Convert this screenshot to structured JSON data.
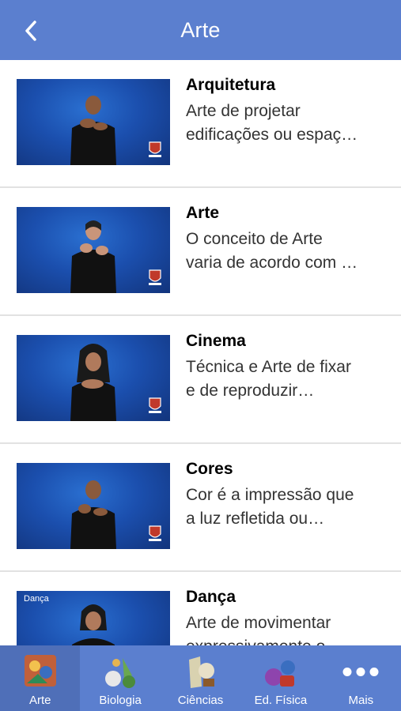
{
  "header": {
    "title": "Arte"
  },
  "items": [
    {
      "name": "Arquitetura",
      "desc1": "Arte de projetar",
      "desc2": "edificações ou espaç…",
      "caption": ""
    },
    {
      "name": "Arte",
      "desc1": "O conceito de Arte",
      "desc2": "varia de acordo com …",
      "caption": ""
    },
    {
      "name": "Cinema",
      "desc1": "Técnica e Arte de fixar",
      "desc2": "e de reproduzir…",
      "caption": ""
    },
    {
      "name": "Cores",
      "desc1": "Cor é a impressão que",
      "desc2": "a luz refletida ou…",
      "caption": ""
    },
    {
      "name": "Dança",
      "desc1": "Arte de movimentar",
      "desc2": "expressivamente o",
      "caption": "Dança"
    }
  ],
  "tabs": [
    {
      "label": "Arte",
      "icon": "arte-icon",
      "active": true
    },
    {
      "label": "Biologia",
      "icon": "biologia-icon",
      "active": false
    },
    {
      "label": "Ciências",
      "icon": "ciencias-icon",
      "active": false
    },
    {
      "label": "Ed. Física",
      "icon": "ed-fisica-icon",
      "active": false
    },
    {
      "label": "Mais",
      "icon": "more-icon",
      "active": false
    }
  ],
  "colors": {
    "header": "#5b7fcf",
    "tabbar": "#5b7fcf",
    "tab_active": "#4f6fb8",
    "video_bg": "#1b4fae"
  }
}
